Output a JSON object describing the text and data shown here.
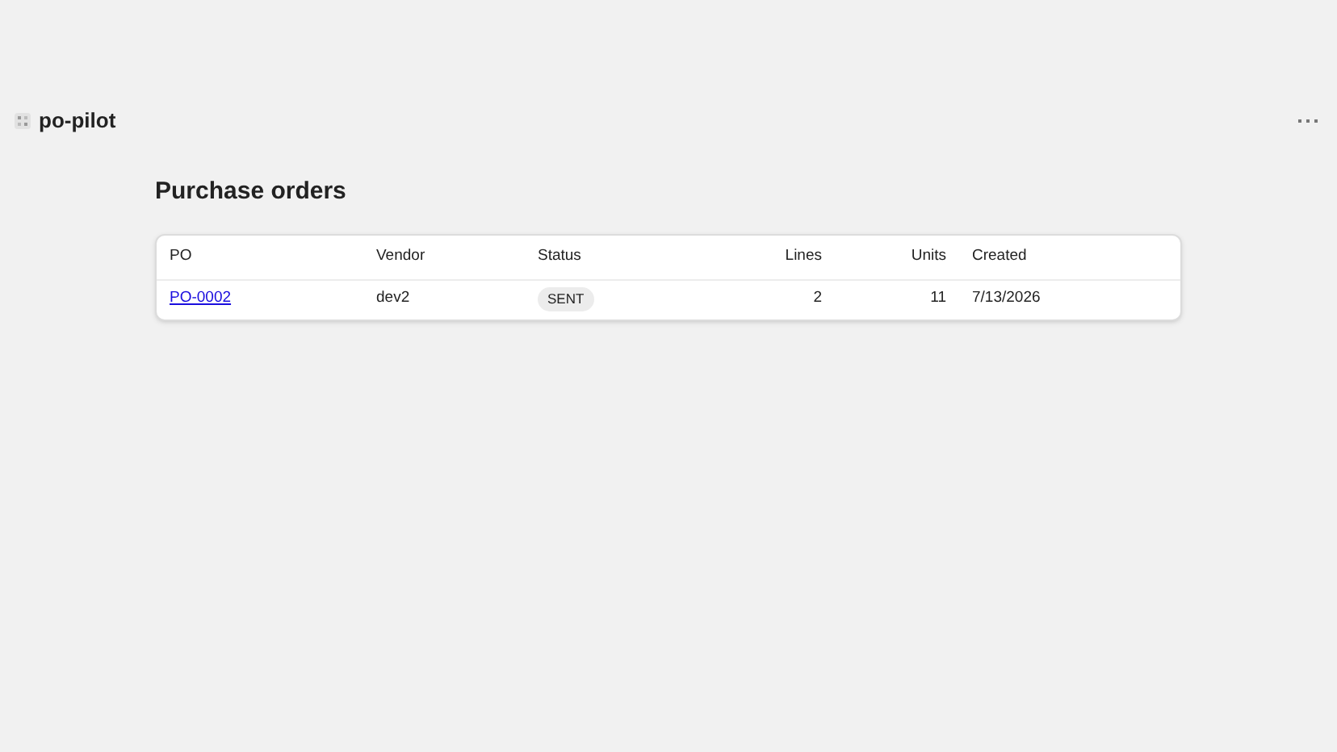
{
  "app": {
    "name": "po-pilot"
  },
  "page": {
    "title": "Purchase orders"
  },
  "table": {
    "columns": [
      "PO",
      "Vendor",
      "Status",
      "Lines",
      "Units",
      "Created"
    ],
    "rows": [
      {
        "po": "PO-0002",
        "vendor": "dev2",
        "status": "SENT",
        "lines": "2",
        "units": "11",
        "created": "7/13/2026"
      }
    ]
  }
}
